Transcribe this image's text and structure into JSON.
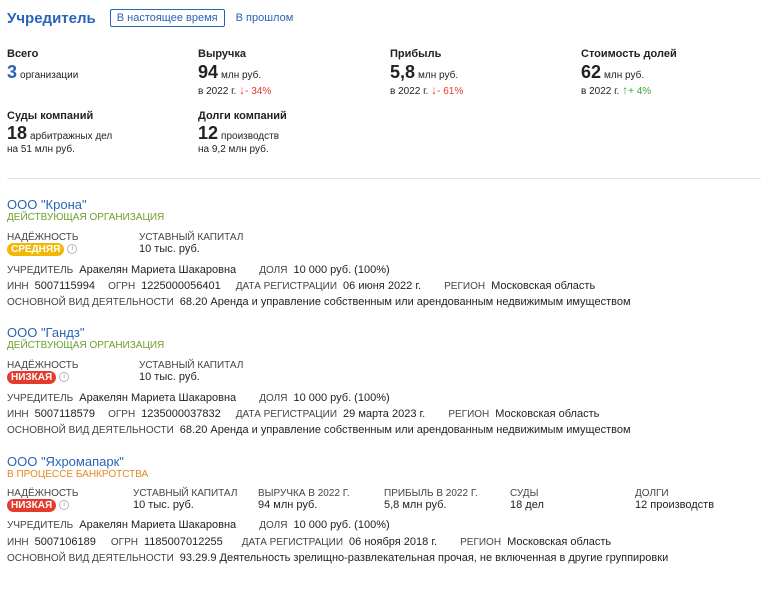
{
  "header": {
    "title": "Учредитель",
    "tabs": [
      {
        "label": "В настоящее время",
        "active": true
      },
      {
        "label": "В прошлом",
        "active": false
      }
    ]
  },
  "stats": {
    "total": {
      "label": "Всего",
      "value": "3",
      "unit": "организации"
    },
    "revenue": {
      "label": "Выручка",
      "value": "94",
      "unit": "млн руб.",
      "year": "в 2022 г.",
      "change": "- 34%",
      "direction": "down"
    },
    "profit": {
      "label": "Прибыль",
      "value": "5,8",
      "unit": "млн руб.",
      "year": "в 2022 г.",
      "change": "- 61%",
      "direction": "down"
    },
    "shares": {
      "label": "Стоимость долей",
      "value": "62",
      "unit": "млн руб.",
      "year": "в 2022 г.",
      "change": "+ 4%",
      "direction": "up"
    },
    "courts": {
      "label": "Суды компаний",
      "value": "18",
      "unit": "арбитражных дел",
      "sub": "на 51 млн руб."
    },
    "debts": {
      "label": "Долги компаний",
      "value": "12",
      "unit": "производств",
      "sub": "на 9,2 млн руб."
    }
  },
  "labels": {
    "reliability": "НАДЁЖНОСТЬ",
    "capital": "УСТАВНЫЙ КАПИТАЛ",
    "founder": "УЧРЕДИТЕЛЬ",
    "share": "ДОЛЯ",
    "inn": "ИНН",
    "ogrn": "ОГРН",
    "reg_date": "ДАТА РЕГИСТРАЦИИ",
    "region": "РЕГИОН",
    "activity": "ОСНОВНОЙ ВИД ДЕЯТЕЛЬНОСТИ",
    "revenue_2022": "ВЫРУЧКА В 2022 Г.",
    "profit_2022": "ПРИБЫЛЬ В 2022 Г.",
    "courts": "СУДЫ",
    "debts": "ДОЛГИ"
  },
  "icons": {
    "arrow_down": "arrow-down-icon",
    "arrow_up": "arrow-up-icon",
    "info": "info-icon"
  },
  "colors": {
    "accent": "#2a63b8",
    "active_status": "#6aa12a",
    "bankrupt_status": "#e08a1e",
    "badge_mid": "#f2b705",
    "badge_low": "#e53b2c",
    "down": "#e53b2c",
    "up": "#3aa33a"
  },
  "orgs": [
    {
      "name": "ООО \"Крона\"",
      "status": "ДЕЙСТВУЮЩАЯ ОРГАНИЗАЦИЯ",
      "reliability": "СРЕДНЯЯ",
      "capital": "10 тыс. руб.",
      "founder": "Аракелян Мариета Шакаровна",
      "share": "10 000 руб. (100%)",
      "inn": "5007115994",
      "ogrn": "1225000056401",
      "reg_date": "06 июня 2022 г.",
      "region": "Московская область",
      "activity": "68.20 Аренда и управление собственным или арендованным недвижимым имуществом"
    },
    {
      "name": "ООО \"Гандз\"",
      "status": "ДЕЙСТВУЮЩАЯ ОРГАНИЗАЦИЯ",
      "reliability": "НИЗКАЯ",
      "capital": "10 тыс. руб.",
      "founder": "Аракелян Мариета Шакаровна",
      "share": "10 000 руб. (100%)",
      "inn": "5007118579",
      "ogrn": "1235000037832",
      "reg_date": "29 марта 2023 г.",
      "region": "Московская область",
      "activity": "68.20 Аренда и управление собственным или арендованным недвижимым имуществом"
    },
    {
      "name": "ООО \"Яхромапарк\"",
      "status": "В ПРОЦЕССЕ БАНКРОТСТВА",
      "reliability": "НИЗКАЯ",
      "capital": "10 тыс. руб.",
      "revenue": "94 млн руб.",
      "profit": "5,8 млн руб.",
      "courts": "18 дел",
      "debts": "12 производств",
      "founder": "Аракелян Мариета Шакаровна",
      "share": "10 000 руб. (100%)",
      "inn": "5007106189",
      "ogrn": "1185007012255",
      "reg_date": "06 ноября 2018 г.",
      "region": "Московская область",
      "activity": "93.29.9 Деятельность зрелищно-развлекательная прочая, не включенная в другие группировки"
    }
  ]
}
